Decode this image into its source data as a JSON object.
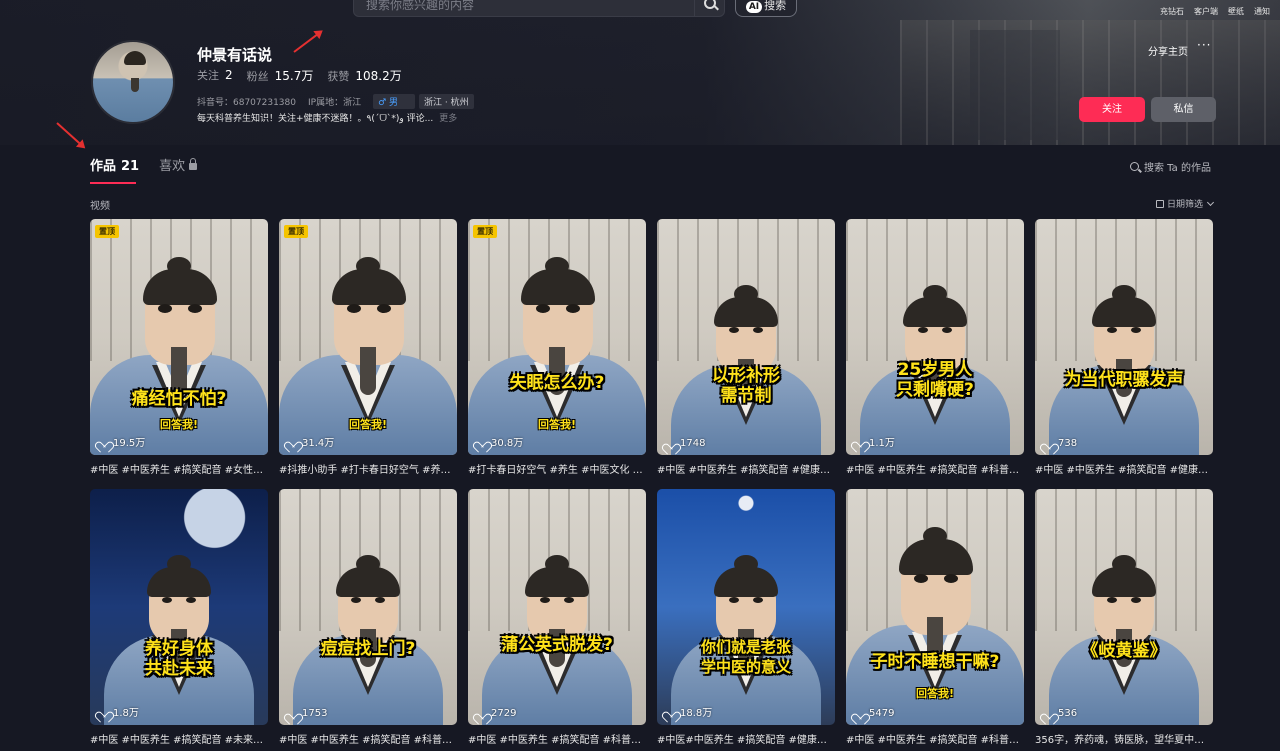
{
  "header": {
    "search_placeholder": "搜索你感兴趣的内容",
    "ai_badge": "AI",
    "ai_search_label": "搜索",
    "top_links": [
      "充钻石",
      "客户端",
      "壁纸",
      "通知"
    ]
  },
  "profile": {
    "nickname": "仲景有话说",
    "following_label": "关注",
    "following": "2",
    "followers_label": "粉丝",
    "followers": "15.7万",
    "likes_label": "获赞",
    "likes": "108.2万",
    "douyin_id": "抖音号：68707231380",
    "ip_location": "IP属地：浙江",
    "gender_tag": "♂ 男",
    "region_tag": "浙江 · 杭州",
    "bio": "每天科普养生知识！关注+健康不迷路！。٩(ˊᗜˋ*)و 评论...",
    "more_label": "更多",
    "share_label": "分享主页",
    "more_icon": "···",
    "follow_label": "关注",
    "message_label": "私信"
  },
  "tabs": [
    {
      "label": "作品",
      "count": "21"
    },
    {
      "label": "喜欢"
    }
  ],
  "search_works_label": "搜索 Ta 的作品",
  "section_label": "视频",
  "date_filter_label": "日期筛选",
  "pin_label": "置顶",
  "videos": [
    {
      "caption": "痛经怕不怕?",
      "reply": "回答我!",
      "likes": "19.5万",
      "desc": "#中医 #中医养生 #搞笑配音 #女性…"
    },
    {
      "caption": "",
      "reply": "回答我!",
      "likes": "31.4万",
      "desc": "#抖推小助手 #打卡春日好空气 #养…"
    },
    {
      "caption": "失眠怎么办?",
      "reply": "回答我!",
      "likes": "30.8万",
      "desc": "#打卡春日好空气 #养生 #中医文化 …"
    },
    {
      "caption": "以形补形\n需节制",
      "likes": "1748",
      "desc": "#中医 #中医养生 #搞笑配音 #健康…"
    },
    {
      "caption": "25岁男人\n只剩嘴硬?",
      "likes": "1.1万",
      "desc": "#中医 #中医养生 #搞笑配音 #科普…"
    },
    {
      "caption": "为当代职骡发声",
      "likes": "738",
      "desc": "#中医 #中医养生 #搞笑配音 #健康…"
    },
    {
      "caption": "养好身体\n共赴未来",
      "likes": "1.8万",
      "desc": "#中医 #中医养生 #搞笑配音 #未来…"
    },
    {
      "caption": "痘痘找上门?",
      "likes": "1753",
      "desc": "#中医 #中医养生 #搞笑配音 #科普…"
    },
    {
      "caption": "蒲公英式脱发?",
      "likes": "2729",
      "desc": "#中医 #中医养生 #搞笑配音 #科普…"
    },
    {
      "caption": "你们就是老张\n学中医的意义",
      "likes": "18.8万",
      "desc": "#中医#中医养生 #搞笑配音 #健康科…"
    },
    {
      "caption": "子时不睡想干嘛?",
      "reply": "回答我!",
      "likes": "5479",
      "desc": "#中医 #中医养生 #搞笑配音 #科普…"
    },
    {
      "caption": "《岐黄鉴》",
      "likes": "536",
      "desc": "356字，养药魂，铸医脉，望华夏中…"
    }
  ]
}
